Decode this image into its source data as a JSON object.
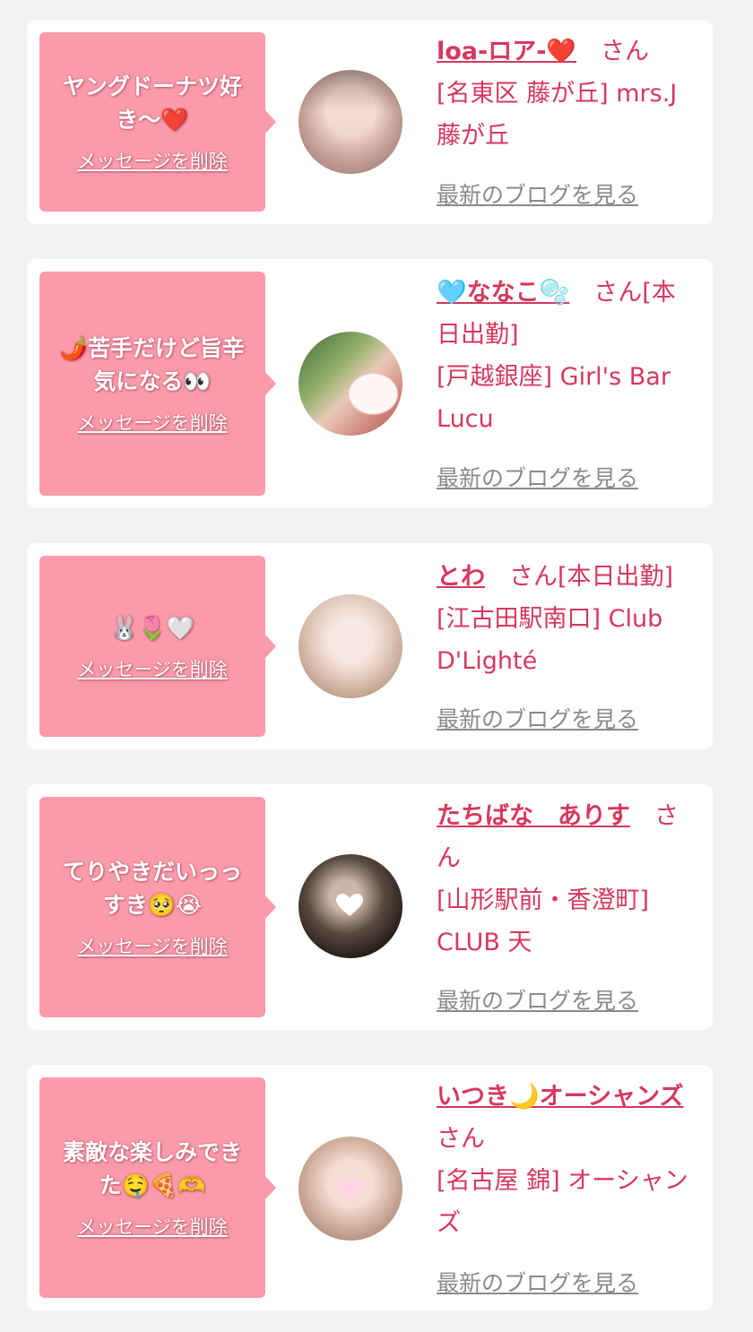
{
  "accent_color": "#d6385e",
  "bubble_color": "#fb9aaa",
  "delete_label": "メッセージを削除",
  "blog_label": "最新のブログを見る",
  "cards": [
    {
      "message": "ヤングドーナツ好き〜❤️",
      "name": "loa-ロア-❤️",
      "suffix": "　さん",
      "shop": "[名東区 藤が丘] mrs.J 藤が丘"
    },
    {
      "message": "🌶️苦手だけど旨辛気になる👀",
      "name": "🩵ななこ🫧",
      "suffix": "　さん[本日出勤]",
      "shop": "[戸越銀座] Girl's Bar Lucu"
    },
    {
      "message": "🐰🌷🤍",
      "name": "とわ",
      "suffix": "　さん[本日出勤]",
      "shop": "[江古田駅南口] Club D'Lighté"
    },
    {
      "message": "てりやきだいっっすき🥺😭",
      "name": "たちばな　ありす",
      "suffix": "　さん",
      "shop": "[山形駅前・香澄町] CLUB 天"
    },
    {
      "message": "素敵な楽しみできた🤤🍕🫶",
      "name": "いつき🌙オーシャンズ",
      "suffix": "　さん",
      "shop": "[名古屋 錦] オーシャンズ"
    }
  ]
}
